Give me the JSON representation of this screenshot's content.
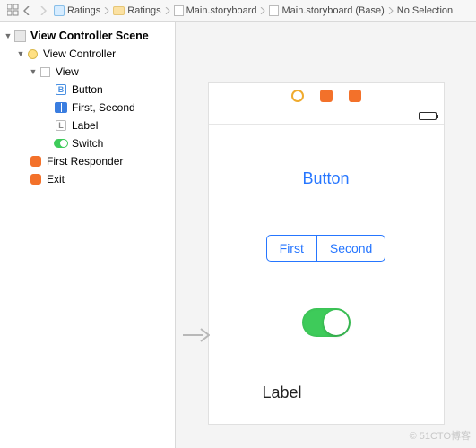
{
  "breadcrumb": {
    "items": [
      {
        "label": "Ratings",
        "icon": "project"
      },
      {
        "label": "Ratings",
        "icon": "folder"
      },
      {
        "label": "Main.storyboard",
        "icon": "storyboard"
      },
      {
        "label": "Main.storyboard (Base)",
        "icon": "storyboard"
      },
      {
        "label": "No Selection",
        "icon": ""
      }
    ]
  },
  "outline": {
    "scene_title": "View Controller Scene",
    "vc_label": "View Controller",
    "view_label": "View",
    "button_label": "Button",
    "segmented_label": "First, Second",
    "label_label": "Label",
    "switch_label": "Switch",
    "first_responder_label": "First Responder",
    "exit_label": "Exit"
  },
  "canvas": {
    "button_text": "Button",
    "seg_first": "First",
    "seg_second": "Second",
    "label_text": "Label"
  },
  "watermark": "© 51CTO博客"
}
